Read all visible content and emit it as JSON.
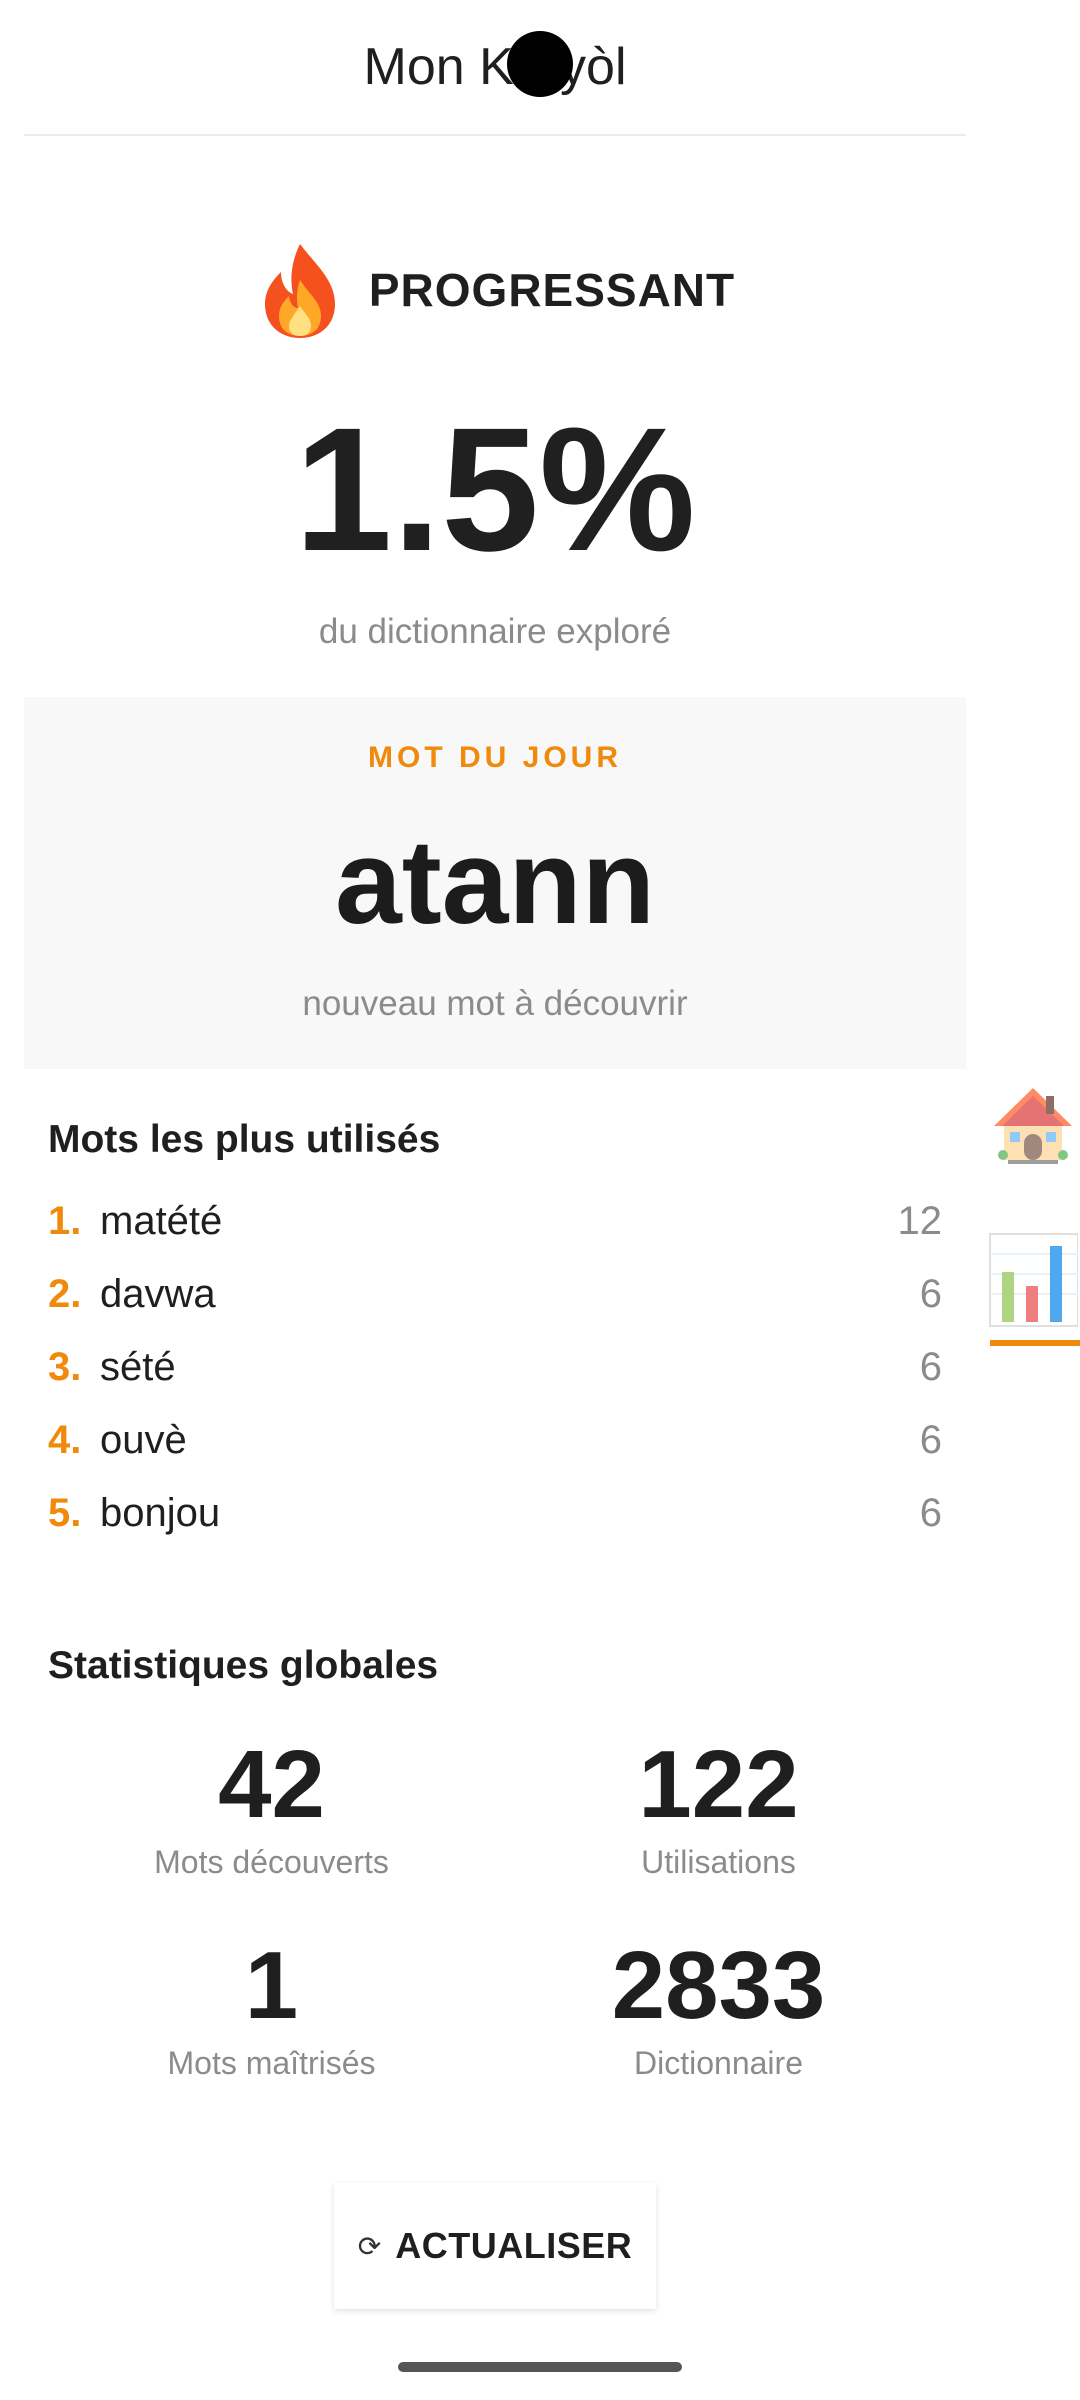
{
  "app": {
    "title": "Mon Kréyòl"
  },
  "level": {
    "icon": "fire-icon",
    "label": "PROGRESSANT"
  },
  "progress": {
    "percent_text": "1.5%",
    "percent_value": 1.5,
    "caption": "du dictionnaire exploré"
  },
  "word_of_day": {
    "label": "MOT DU JOUR",
    "word": "atann",
    "caption": "nouveau mot à découvrir"
  },
  "top_words": {
    "title": "Mots les plus utilisés",
    "items": [
      {
        "rank": "1.",
        "word": "matété",
        "count": "12"
      },
      {
        "rank": "2.",
        "word": "davwa",
        "count": "6"
      },
      {
        "rank": "3.",
        "word": "sété",
        "count": "6"
      },
      {
        "rank": "4.",
        "word": "ouvè",
        "count": "6"
      },
      {
        "rank": "5.",
        "word": "bonjou",
        "count": "6"
      }
    ]
  },
  "global_stats": {
    "title": "Statistiques globales",
    "items": [
      {
        "value": "42",
        "label": "Mots découverts"
      },
      {
        "value": "122",
        "label": "Utilisations"
      },
      {
        "value": "1",
        "label": "Mots maîtrisés"
      },
      {
        "value": "2833",
        "label": "Dictionnaire"
      }
    ]
  },
  "refresh": {
    "icon": "refresh-icon",
    "label": "ACTUALISER"
  },
  "side_nav": {
    "items": [
      {
        "icon": "house-icon"
      },
      {
        "icon": "bar-chart-icon",
        "active": true
      }
    ]
  },
  "colors": {
    "accent": "#f08a0c",
    "text": "#1f1f1f",
    "muted": "#8b8b8b",
    "card_bg": "#f8f8f8"
  }
}
